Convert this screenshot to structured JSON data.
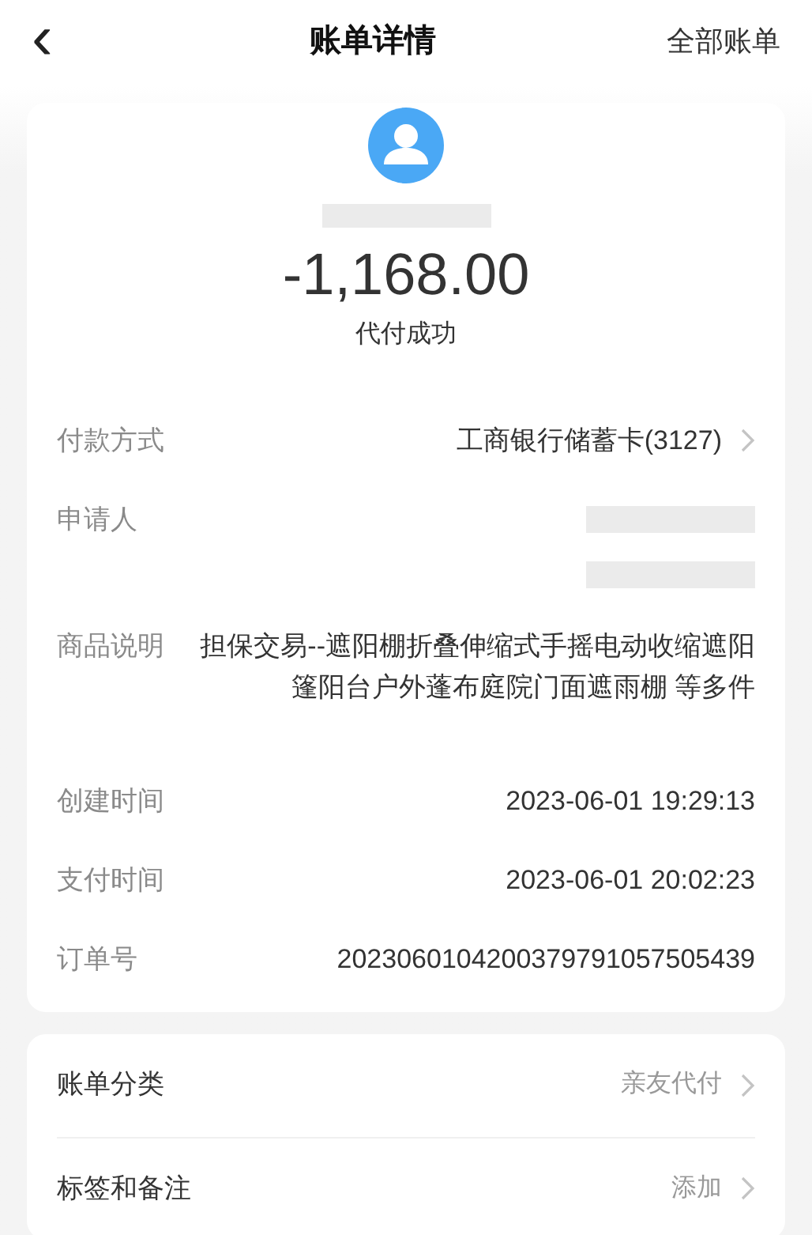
{
  "header": {
    "back_icon": "‹",
    "title": "账单详情",
    "action": "全部账单"
  },
  "summary": {
    "name_redacted": true,
    "amount": "-1,168.00",
    "status": "代付成功"
  },
  "details": [
    {
      "kind": "link",
      "label": "付款方式",
      "value": "工商银行储蓄卡(3127)"
    },
    {
      "kind": "redacted",
      "label": "申请人"
    },
    {
      "kind": "text",
      "label": "商品说明",
      "value": "担保交易--遮阳棚折叠伸缩式手摇电动收缩遮阳篷阳台户外蓬布庭院门面遮雨棚 等多件"
    },
    {
      "kind": "text",
      "label": "创建时间",
      "value": "2023-06-01 19:29:13"
    },
    {
      "kind": "text",
      "label": "支付时间",
      "value": "2023-06-01 20:02:23"
    },
    {
      "kind": "text",
      "label": "订单号",
      "value": "2023060104200379791057505439"
    }
  ],
  "extras": [
    {
      "label": "账单分类",
      "value": "亲友代付"
    },
    {
      "label": "标签和备注",
      "value": "添加"
    }
  ]
}
